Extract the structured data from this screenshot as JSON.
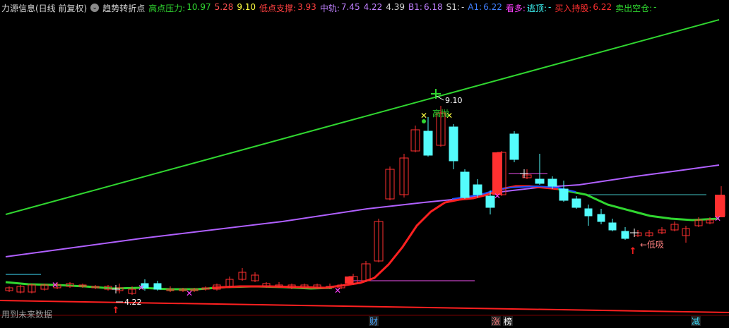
{
  "header": {
    "stock_title": "力源信息(日线 前复权)",
    "dropdown_glyph": "⌄",
    "indicator_name": "趋势转折点",
    "items": [
      {
        "label": "高点压力:",
        "values": [
          "10.97",
          "5.28",
          "9.10"
        ],
        "color": "#30d630",
        "value_colors": [
          "#30d630",
          "#ff5050",
          "#ffff40"
        ]
      },
      {
        "label": "低点支撑:",
        "values": [
          "3.93"
        ],
        "color": "#ff4040",
        "value_colors": [
          "#ff4040"
        ]
      },
      {
        "label": "中轨:",
        "values": [
          "7.45",
          "4.22",
          "4.39"
        ],
        "color": "#c080ff",
        "value_colors": [
          "#c080ff",
          "#c080ff",
          "#d6d6d6"
        ]
      },
      {
        "label": "B1:",
        "values": [
          "6.18"
        ],
        "color": "#c080ff",
        "value_colors": [
          "#c080ff"
        ]
      },
      {
        "label": "S1:",
        "values": [
          "-"
        ],
        "color": "#d6d6d6",
        "value_colors": [
          "#d6d6d6"
        ]
      },
      {
        "label": "A1:",
        "values": [
          "6.22"
        ],
        "color": "#4080ff",
        "value_colors": [
          "#4080ff"
        ]
      },
      {
        "label": "看多:",
        "values": [],
        "color": "#ff40ff",
        "value_colors": []
      },
      {
        "label": "逃顶:",
        "values": [
          "-"
        ],
        "color": "#40ffff",
        "value_colors": [
          "#40ffff"
        ]
      },
      {
        "label": "买入持股:",
        "values": [
          "6.22"
        ],
        "color": "#ff3030",
        "value_colors": [
          "#ff3030"
        ]
      },
      {
        "label": "卖出空仓:",
        "values": [
          "-"
        ],
        "color": "#30d630",
        "value_colors": [
          "#30d630"
        ]
      }
    ]
  },
  "annotations": {
    "peak_value": "9.10",
    "peak_text": "高抛",
    "low_value": "4.22",
    "low_text": "低吸"
  },
  "bottom_marks": [
    {
      "text": "财",
      "color": "#4aa8ff"
    },
    {
      "text": "涨",
      "color": "#ff8080"
    },
    {
      "text": "榜",
      "color": "#ffffff"
    },
    {
      "text": "减",
      "color": "#40e0ff"
    }
  ],
  "footer_text": "用到未来数据",
  "colors": {
    "up": "#ff3030",
    "down": "#54fcfc",
    "resistance_line": "#30d630",
    "support_line": "#ff2020",
    "mid_line": "#b060ff",
    "trend_line": "#ff2020",
    "trend_line_alt": "#30d630",
    "blue_line": "#2050ff"
  }
}
